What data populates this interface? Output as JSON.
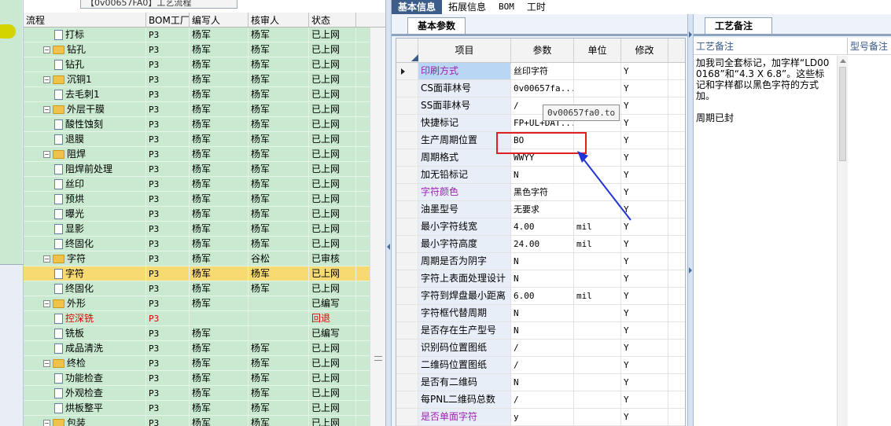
{
  "tree": {
    "title": "【0v00657FA0】工艺流程",
    "headers": [
      "流程",
      "BOM工厂",
      "编写人",
      "核审人",
      "状态"
    ],
    "rows": [
      {
        "name": "打标",
        "bom": "P3",
        "writer": "杨军",
        "reviewer": "杨军",
        "status": "已上网",
        "level": 2
      },
      {
        "name": "钻孔",
        "bom": "P3",
        "writer": "杨军",
        "reviewer": "杨军",
        "status": "已上网",
        "level": 1
      },
      {
        "name": "钻孔",
        "bom": "P3",
        "writer": "杨军",
        "reviewer": "杨军",
        "status": "已上网",
        "level": 2
      },
      {
        "name": "沉铜1",
        "bom": "P3",
        "writer": "杨军",
        "reviewer": "杨军",
        "status": "已上网",
        "level": 1
      },
      {
        "name": "去毛刺1",
        "bom": "P3",
        "writer": "杨军",
        "reviewer": "杨军",
        "status": "已上网",
        "level": 2
      },
      {
        "name": "外层干膜",
        "bom": "P3",
        "writer": "杨军",
        "reviewer": "杨军",
        "status": "已上网",
        "level": 1
      },
      {
        "name": "酸性蚀刻",
        "bom": "P3",
        "writer": "杨军",
        "reviewer": "杨军",
        "status": "已上网",
        "level": 2
      },
      {
        "name": "退膜",
        "bom": "P3",
        "writer": "杨军",
        "reviewer": "杨军",
        "status": "已上网",
        "level": 2
      },
      {
        "name": "阻焊",
        "bom": "P3",
        "writer": "杨军",
        "reviewer": "杨军",
        "status": "已上网",
        "level": 1
      },
      {
        "name": "阻焊前处理",
        "bom": "P3",
        "writer": "杨军",
        "reviewer": "杨军",
        "status": "已上网",
        "level": 2
      },
      {
        "name": "丝印",
        "bom": "P3",
        "writer": "杨军",
        "reviewer": "杨军",
        "status": "已上网",
        "level": 2
      },
      {
        "name": "预烘",
        "bom": "P3",
        "writer": "杨军",
        "reviewer": "杨军",
        "status": "已上网",
        "level": 2
      },
      {
        "name": "曝光",
        "bom": "P3",
        "writer": "杨军",
        "reviewer": "杨军",
        "status": "已上网",
        "level": 2
      },
      {
        "name": "显影",
        "bom": "P3",
        "writer": "杨军",
        "reviewer": "杨军",
        "status": "已上网",
        "level": 2
      },
      {
        "name": "终固化",
        "bom": "P3",
        "writer": "杨军",
        "reviewer": "杨军",
        "status": "已上网",
        "level": 2
      },
      {
        "name": "字符",
        "bom": "P3",
        "writer": "杨军",
        "reviewer": "谷松",
        "status": "已审核",
        "level": 1
      },
      {
        "name": "字符",
        "bom": "P3",
        "writer": "杨军",
        "reviewer": "杨军",
        "status": "已上网",
        "level": 2,
        "selected": true
      },
      {
        "name": "终固化",
        "bom": "P3",
        "writer": "杨军",
        "reviewer": "杨军",
        "status": "已上网",
        "level": 2
      },
      {
        "name": "外形",
        "bom": "P3",
        "writer": "杨军",
        "reviewer": "",
        "status": "已编写",
        "level": 1
      },
      {
        "name": "控深铣",
        "bom": "P3",
        "writer": "",
        "reviewer": "",
        "status": "回退",
        "level": 2,
        "red": true
      },
      {
        "name": "铣板",
        "bom": "P3",
        "writer": "杨军",
        "reviewer": "",
        "status": "已编写",
        "level": 2
      },
      {
        "name": "成品清洗",
        "bom": "P3",
        "writer": "杨军",
        "reviewer": "杨军",
        "status": "已上网",
        "level": 2
      },
      {
        "name": "终检",
        "bom": "P3",
        "writer": "杨军",
        "reviewer": "杨军",
        "status": "已上网",
        "level": 1
      },
      {
        "name": "功能检查",
        "bom": "P3",
        "writer": "杨军",
        "reviewer": "杨军",
        "status": "已上网",
        "level": 2
      },
      {
        "name": "外观检查",
        "bom": "P3",
        "writer": "杨军",
        "reviewer": "杨军",
        "status": "已上网",
        "level": 2
      },
      {
        "name": "烘板整平",
        "bom": "P3",
        "writer": "杨军",
        "reviewer": "杨军",
        "status": "已上网",
        "level": 2
      },
      {
        "name": "包装",
        "bom": "P3",
        "writer": "杨军",
        "reviewer": "杨军",
        "status": "已上网",
        "level": 1
      }
    ]
  },
  "top_tabs": [
    "基本信息",
    "拓展信息",
    "BOM",
    "工时"
  ],
  "param_panel": {
    "tab": "基本参数",
    "headers": [
      "项目",
      "参数",
      "单位",
      "修改"
    ],
    "rows": [
      {
        "item": "印刷方式",
        "param": "丝印字符",
        "unit": "",
        "mod": "Y",
        "purple": true
      },
      {
        "item": "CS面菲林号",
        "param": "0v00657fa...",
        "unit": "",
        "mod": "Y"
      },
      {
        "item": "SS面菲林号",
        "param": "/",
        "unit": "",
        "mod": "Y"
      },
      {
        "item": "快捷标记",
        "param": "FP+UL+DAT...",
        "unit": "",
        "mod": "Y"
      },
      {
        "item": "生产周期位置",
        "param": "BO",
        "unit": "",
        "mod": "Y"
      },
      {
        "item": "周期格式",
        "param": "WWYY",
        "unit": "",
        "mod": "Y"
      },
      {
        "item": "加无铅标记",
        "param": "N",
        "unit": "",
        "mod": "Y"
      },
      {
        "item": "字符颜色",
        "param": "黑色字符",
        "unit": "",
        "mod": "Y",
        "purple": true
      },
      {
        "item": "油墨型号",
        "param": "无要求",
        "unit": "",
        "mod": "Y"
      },
      {
        "item": "最小字符线宽",
        "param": "4.00",
        "unit": "mil",
        "mod": "Y"
      },
      {
        "item": "最小字符高度",
        "param": "24.00",
        "unit": "mil",
        "mod": "Y"
      },
      {
        "item": "周期是否为阴字",
        "param": "N",
        "unit": "",
        "mod": "Y"
      },
      {
        "item": "字符上表面处理设计",
        "param": "N",
        "unit": "",
        "mod": "Y"
      },
      {
        "item": "字符到焊盘最小距离",
        "param": "6.00",
        "unit": "mil",
        "mod": "Y"
      },
      {
        "item": "字符框代替周期",
        "param": "N",
        "unit": "",
        "mod": "Y"
      },
      {
        "item": "是否存在生产型号",
        "param": "N",
        "unit": "",
        "mod": "Y"
      },
      {
        "item": "识别码位置图纸",
        "param": "/",
        "unit": "",
        "mod": "Y"
      },
      {
        "item": "二维码位置图纸",
        "param": "/",
        "unit": "",
        "mod": "Y"
      },
      {
        "item": "是否有二维码",
        "param": "N",
        "unit": "",
        "mod": "Y"
      },
      {
        "item": "每PNL二维码总数",
        "param": "/",
        "unit": "",
        "mod": "Y"
      },
      {
        "item": "是否单面字符",
        "param": "y",
        "unit": "",
        "mod": "Y",
        "purple": true
      }
    ],
    "tooltip": "0v00657fa0.to"
  },
  "notes_panel": {
    "tab": "工艺备注",
    "headers": [
      "工艺备注",
      "型号备注"
    ],
    "paragraphs": [
      "加我司全套标记，加字样“LD000168”和“4.3 X 6.8”。这些标记和字样都以黑色字符的方式加。",
      "周期已封"
    ]
  },
  "colors": {
    "tree_row_bg": "#c9ead0",
    "selected_row_bg": "#f8da72",
    "active_tab_bg": "#3c5d8a",
    "highlight_box": "#e02020",
    "annotation_arrow": "#2034d8",
    "purple_text": "#9c23b0"
  }
}
